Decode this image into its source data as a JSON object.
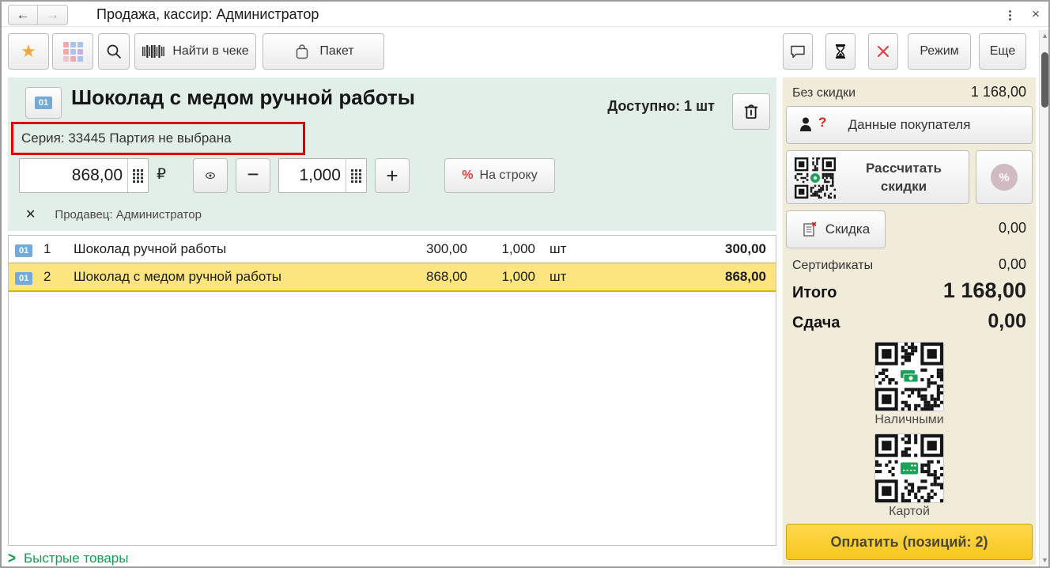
{
  "colors": {
    "accent_green": "#169b57",
    "panel_green": "#e2efe8",
    "panel_cream": "#f1ecd9",
    "selection_yellow": "#fce47e",
    "annotation_red": "#dd0000",
    "pay_yellow": "#f6c71e",
    "badge_blue": "#74aad9"
  },
  "icons": {
    "back_arrow": "←",
    "forward_arrow": "→",
    "close": "×",
    "star": "★",
    "minus": "−",
    "plus": "+",
    "percent": "%",
    "clear_x": "✕",
    "chevron_right": ">",
    "arrow_up": "▲",
    "arrow_down": "▼"
  },
  "titlebar": {
    "title": "Продажа, кассир: Администратор"
  },
  "toolbar": {
    "find_in_receipt_label": "Найти в чеке",
    "package_label": "Пакет",
    "mode_label": "Режим",
    "more_label": "Еще"
  },
  "product": {
    "badge": "01",
    "name": "Шоколад с медом ручной работы",
    "available": "Доступно: 1 шт",
    "series": "Серия: 33445 Партия не выбрана",
    "price": "868,00",
    "currency": "₽",
    "quantity": "1,000",
    "per_line_label": "На строку",
    "seller": "Продавец: Администратор"
  },
  "receipt": {
    "rows": [
      {
        "badge": "01",
        "num": "1",
        "name": "Шоколад ручной работы",
        "price": "300,00",
        "qty": "1,000",
        "unit": "шт",
        "total": "300,00"
      },
      {
        "badge": "01",
        "num": "2",
        "name": "Шоколад с медом ручной работы",
        "price": "868,00",
        "qty": "1,000",
        "unit": "шт",
        "total": "868,00"
      }
    ]
  },
  "quick_goods_label": "Быстрые товары",
  "summary": {
    "no_discount_label": "Без скидки",
    "no_discount_value": "1 168,00",
    "customer_data_label": "Данные покупателя",
    "calc_discounts_label": "Рассчитать скидки",
    "discount_label": "Скидка",
    "discount_value": "0,00",
    "certificates_label": "Сертификаты",
    "certificates_value": "0,00",
    "total_label": "Итого",
    "total_value": "1 168,00",
    "change_label": "Сдача",
    "change_value": "0,00",
    "cash_label": "Наличными",
    "card_label": "Картой",
    "pay_label": "Оплатить (позиций: 2)"
  }
}
